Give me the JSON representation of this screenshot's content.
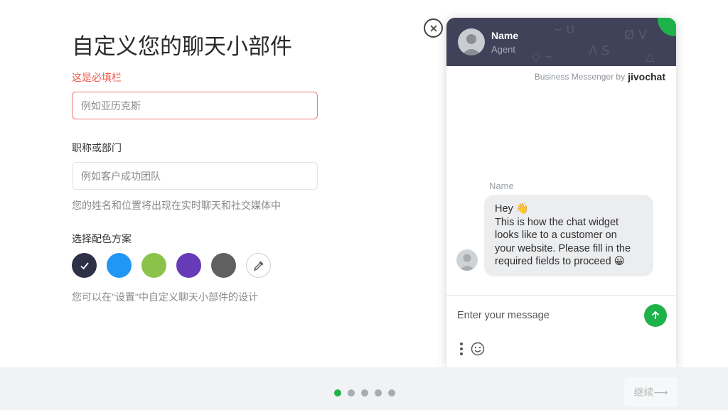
{
  "form": {
    "title": "自定义您的聊天小部件",
    "required_label": "这是必填栏",
    "name_placeholder": "例如亚历克斯",
    "dept_label": "职称或部门",
    "dept_placeholder": "例如客户成功团队",
    "name_hint": "您的姓名和位置将出现在实时聊天和社交媒体中",
    "scheme_label": "选择配色方案",
    "swatches": [
      "#2d3047",
      "#2196f3",
      "#8bc34a",
      "#673ab7",
      "#606060"
    ],
    "selected_swatch": "#2d3047",
    "settings_hint": "您可以在\"设置\"中自定义聊天小部件的设计"
  },
  "widget": {
    "agent_name": "Name",
    "agent_role": "Agent",
    "powered_by": "Business Messenger by",
    "brand": "jivochat",
    "message_sender": "Name",
    "message_lines": [
      "Hey 👋",
      "This is how the chat widget",
      "looks like to a customer on",
      "your website. Please fill in the",
      "required fields to proceed 😀"
    ],
    "input_placeholder": "Enter your message",
    "header_color": "#3f4258",
    "accent_color": "#1fb24a"
  },
  "footer": {
    "pagination_total": 5,
    "pagination_current": 1,
    "continue_label": "继续⟶"
  }
}
